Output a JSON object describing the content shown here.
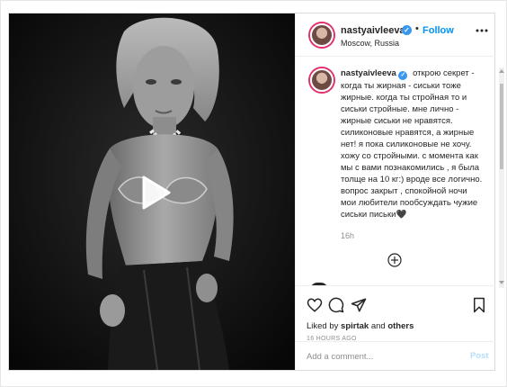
{
  "post": {
    "author": {
      "username": "nastyaivleeva",
      "verified_mark": "✓",
      "separator": "•",
      "follow_label": "Follow",
      "location": "Moscow, Russia"
    },
    "more_icon": "ellipsis-icon",
    "media": {
      "type": "video",
      "play_icon": "play-icon"
    },
    "caption": {
      "username": "nastyaivleeva",
      "text": "открою секрет - когда ты жирная - сиськи тоже жирные. когда ты стройная то и сиськи стройные. мне лично - жирные сиськи не нравятся. силиконовые нравятся, а жирные нет! я пока силиконовые не хочу. хожу со стройными. с момента как мы с вами познакомились , я была толще на 10 кг:) вроде все логично. вопрос закрыт , спокойной ночи мои любители пообсуждать чужие сиськи письки🖤",
      "time": "16h"
    },
    "load_more_icon": "plus-circle-icon",
    "actions": {
      "like_icon": "heart-icon",
      "comment_icon": "comment-icon",
      "share_icon": "share-icon",
      "save_icon": "bookmark-icon"
    },
    "likes": {
      "prefix": "Liked by ",
      "user": "spirtak",
      "middle": " and ",
      "others": "others"
    },
    "posted_at": "16 HOURS AGO",
    "comment_box": {
      "placeholder": "Add a comment...",
      "post_label": "Post"
    }
  },
  "colors": {
    "accent": "#0095f6",
    "verified": "#3897f0",
    "muted": "#8e8e8e",
    "border": "#dbdbdb",
    "post_disabled": "#b2dffc"
  }
}
